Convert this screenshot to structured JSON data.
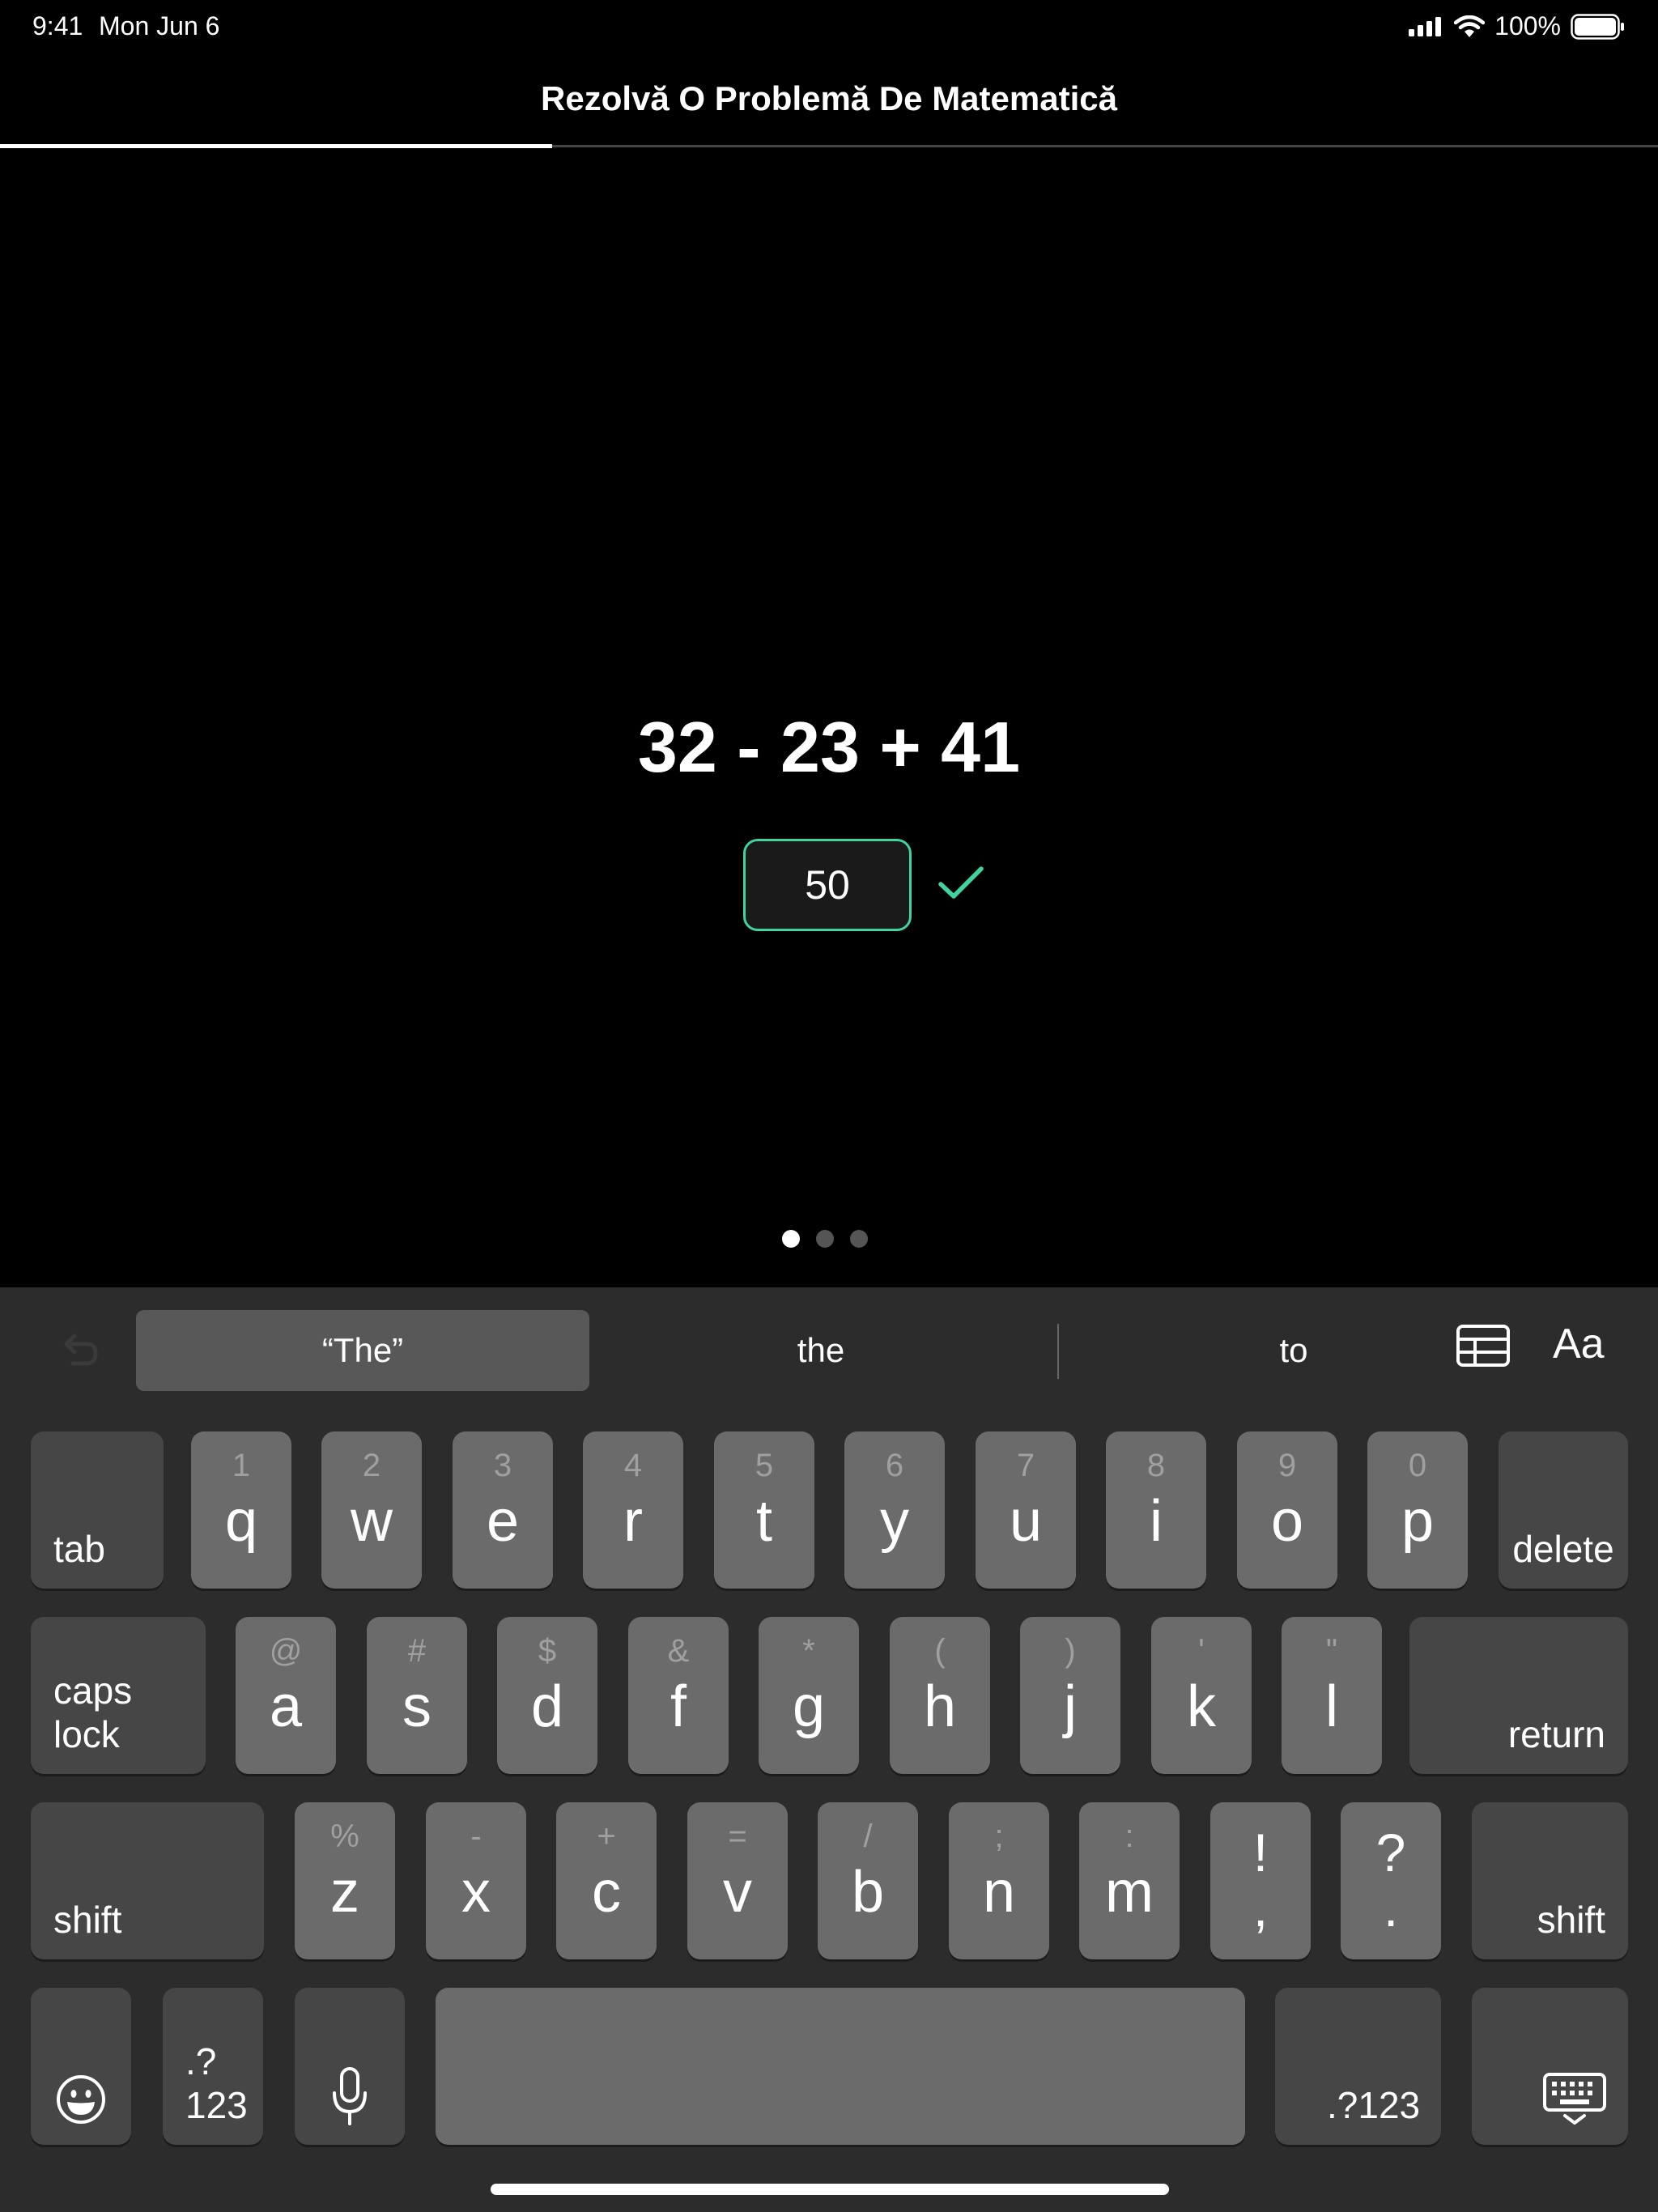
{
  "status_bar": {
    "time": "9:41",
    "date": "Mon Jun 6",
    "battery": "100%"
  },
  "header": {
    "title": "Rezolvă O Problemă De Matematică",
    "progress_fraction": 0.333
  },
  "problem": {
    "expression": "32 - 23 + 41",
    "answer": "50",
    "status": "correct",
    "accent_color": "#3fd3a0"
  },
  "pagination": {
    "current": 1,
    "total": 3
  },
  "keyboard": {
    "suggestions": [
      "“The”",
      "the",
      "to"
    ],
    "aa_label": "Aa",
    "row1": {
      "tab": "tab",
      "keys": [
        {
          "main": "q",
          "alt": "1"
        },
        {
          "main": "w",
          "alt": "2"
        },
        {
          "main": "e",
          "alt": "3"
        },
        {
          "main": "r",
          "alt": "4"
        },
        {
          "main": "t",
          "alt": "5"
        },
        {
          "main": "y",
          "alt": "6"
        },
        {
          "main": "u",
          "alt": "7"
        },
        {
          "main": "i",
          "alt": "8"
        },
        {
          "main": "o",
          "alt": "9"
        },
        {
          "main": "p",
          "alt": "0"
        }
      ],
      "delete": "delete"
    },
    "row2": {
      "caps": "caps lock",
      "keys": [
        {
          "main": "a",
          "alt": "@"
        },
        {
          "main": "s",
          "alt": "#"
        },
        {
          "main": "d",
          "alt": "$"
        },
        {
          "main": "f",
          "alt": "&"
        },
        {
          "main": "g",
          "alt": "*"
        },
        {
          "main": "h",
          "alt": "("
        },
        {
          "main": "j",
          "alt": ")"
        },
        {
          "main": "k",
          "alt": "'"
        },
        {
          "main": "l",
          "alt": "\""
        }
      ],
      "return": "return"
    },
    "row3": {
      "shift_left": "shift",
      "keys": [
        {
          "main": "z",
          "alt": "%"
        },
        {
          "main": "x",
          "alt": "-"
        },
        {
          "main": "c",
          "alt": "+"
        },
        {
          "main": "v",
          "alt": "="
        },
        {
          "main": "b",
          "alt": "/"
        },
        {
          "main": "n",
          "alt": ";"
        },
        {
          "main": "m",
          "alt": ":"
        },
        {
          "main": ",",
          "alt": "!"
        },
        {
          "main": ".",
          "alt": "?"
        }
      ],
      "shift_right": "shift"
    },
    "row4": {
      "numbers_left": ".?123",
      "numbers_right": ".?123"
    }
  }
}
